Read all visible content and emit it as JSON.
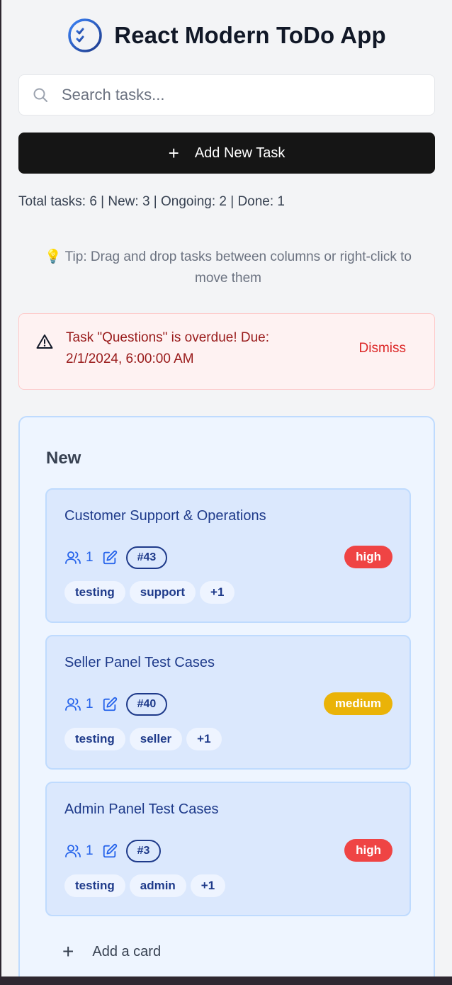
{
  "header": {
    "title": "React Modern ToDo App",
    "logo_icon": "checklist-icon"
  },
  "search": {
    "placeholder": "Search tasks...",
    "value": "",
    "icon": "search-icon"
  },
  "add_task": {
    "icon": "plus-icon",
    "label": "Add New Task"
  },
  "stats": {
    "text": "Total tasks: 6 | New: 3 | Ongoing: 2 | Done: 1"
  },
  "tip": {
    "icon": "💡",
    "text": "Tip: Drag and drop tasks between columns or right-click to move them"
  },
  "alert": {
    "icon": "warning-triangle-icon",
    "message": "Task \"Questions\" is overdue! Due: 2/1/2024, 6:00:00 AM",
    "dismiss_label": "Dismiss"
  },
  "column": {
    "title": "New",
    "cards": [
      {
        "title": "Customer Support & Operations",
        "assignees": "1",
        "number": "#43",
        "priority": "high",
        "priority_color": "#ef4444",
        "tags": [
          "testing",
          "support",
          "+1"
        ]
      },
      {
        "title": "Seller Panel Test Cases",
        "assignees": "1",
        "number": "#40",
        "priority": "medium",
        "priority_color": "#eab308",
        "tags": [
          "testing",
          "seller",
          "+1"
        ]
      },
      {
        "title": "Admin Panel Test Cases",
        "assignees": "1",
        "number": "#3",
        "priority": "high",
        "priority_color": "#ef4444",
        "tags": [
          "testing",
          "admin",
          "+1"
        ]
      }
    ],
    "add_card_label": "Add a card"
  },
  "colors": {
    "accent": "#2563eb",
    "button_bg": "#151515",
    "alert_text": "#991b1b",
    "dismiss": "#dc2626"
  }
}
